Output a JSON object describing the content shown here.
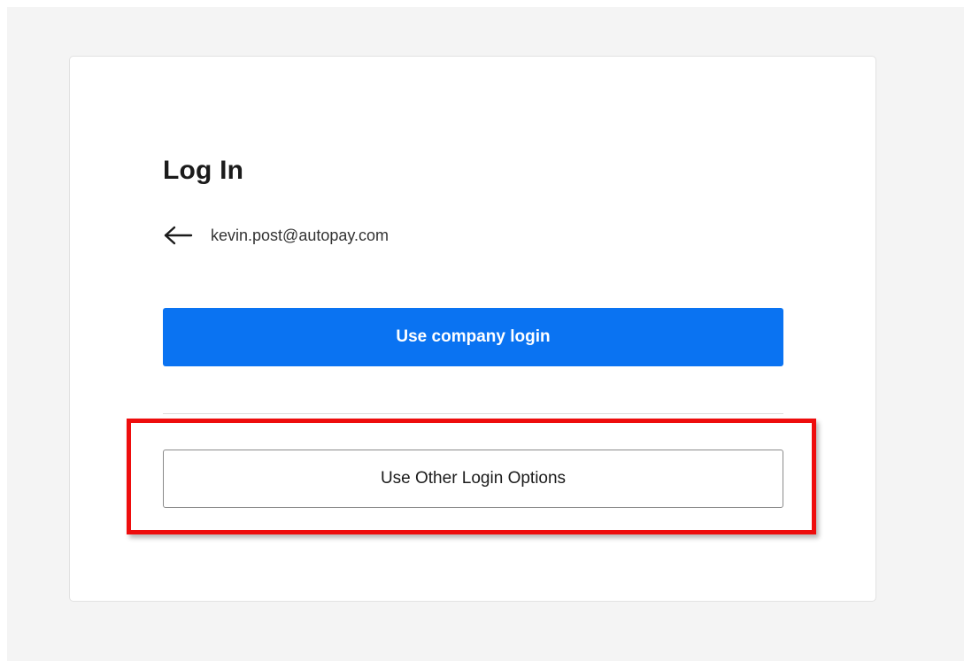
{
  "login": {
    "title": "Log In",
    "email": "kevin.post@autopay.com",
    "back_icon": "arrow-left-icon",
    "primary_button_label": "Use company login",
    "secondary_button_label": "Use Other Login Options"
  },
  "colors": {
    "page_background": "#f4f4f4",
    "card_background": "#ffffff",
    "primary_button": "#0a73f2",
    "highlight": "#ee0d0d"
  }
}
